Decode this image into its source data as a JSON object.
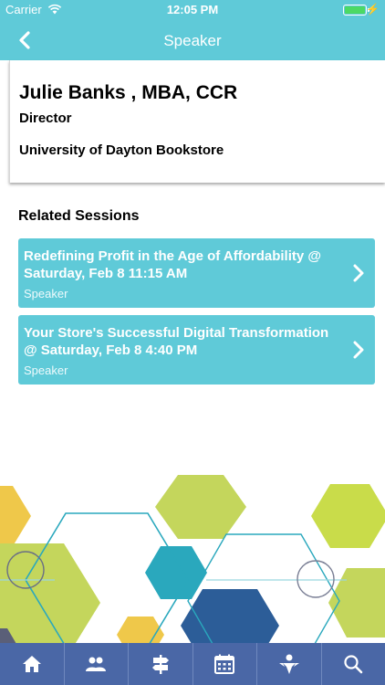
{
  "status": {
    "carrier": "Carrier",
    "time": "12:05 PM"
  },
  "nav": {
    "title": "Speaker"
  },
  "speaker": {
    "name": "Julie Banks , MBA, CCR",
    "role": "Director",
    "organization": "University of Dayton Bookstore"
  },
  "related": {
    "heading": "Related Sessions",
    "sessions": [
      {
        "title": "Redefining Profit in the Age of Affordability @ Saturday, Feb 8 11:15 AM",
        "role": "Speaker"
      },
      {
        "title": "Your Store's Successful Digital Transformation @ Saturday, Feb 8 4:40 PM",
        "role": "Speaker"
      }
    ]
  },
  "tabs": [
    "home-icon",
    "people-icon",
    "signpost-icon",
    "calendar-icon",
    "sponsor-icon",
    "search-icon"
  ],
  "colors": {
    "accent": "#5fcad8",
    "tabbar": "#4a67a6",
    "battery": "#4cd964"
  }
}
